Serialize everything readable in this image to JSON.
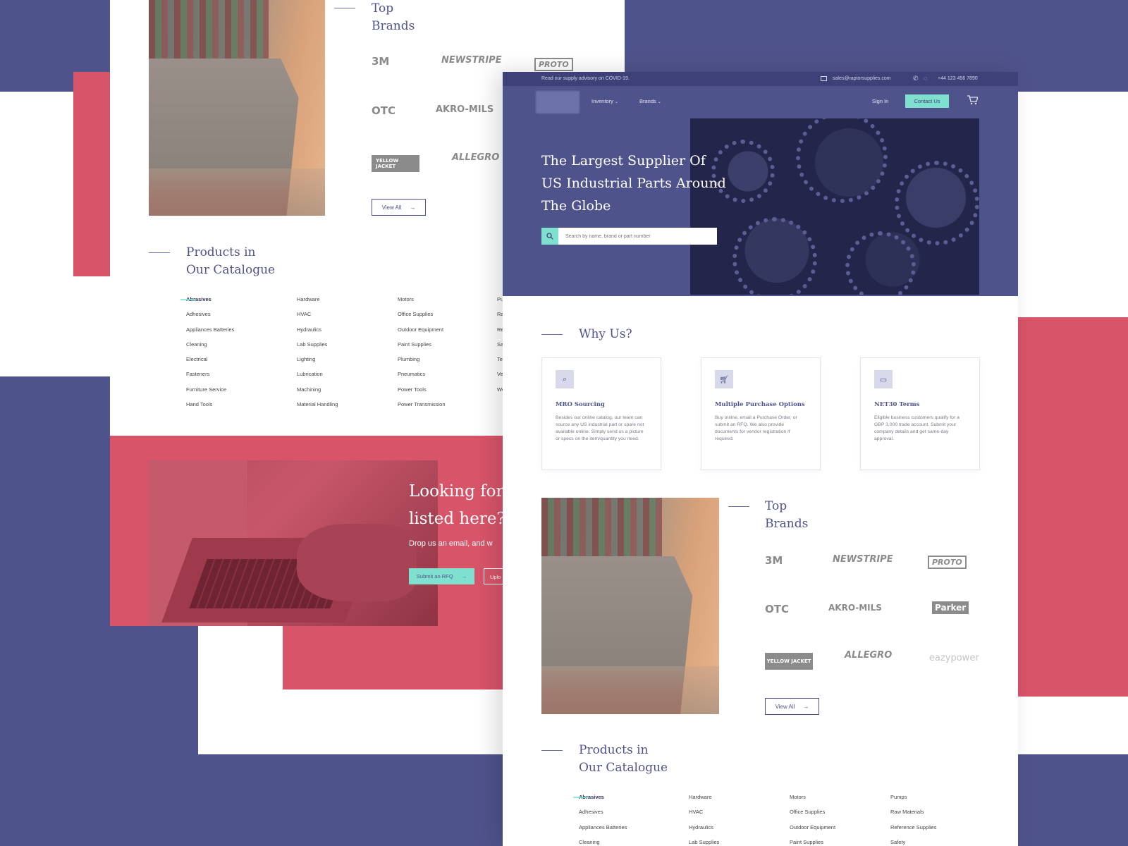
{
  "colors": {
    "primary_purple": "#4f538b",
    "accent_red": "#d85469",
    "accent_mint": "#7fe0cf"
  },
  "back_page": {
    "top_brands_title": [
      "Top",
      "Brands"
    ],
    "brands": [
      "3M",
      "NEWSTRIPE",
      "PROTO",
      "OTC",
      "AKRO-MILS",
      "YELLOW JACKET",
      "ALLEGRO"
    ],
    "view_all_label": "View All",
    "catalogue_title": [
      "Products in",
      "Our Catalogue"
    ],
    "catalogue_columns": [
      [
        "Abrasives",
        "Adhesives",
        "Appliances Batteries",
        "Cleaning",
        "Electrical",
        "Fasteners",
        "Furniture Service",
        "Hand Tools"
      ],
      [
        "Hardware",
        "HVAC",
        "Hydraulics",
        "Lab Supplies",
        "Lighting",
        "Lubrication",
        "Machining",
        "Material Handling"
      ],
      [
        "Motors",
        "Office Supplies",
        "Outdoor Equipment",
        "Paint Supplies",
        "Plumbing",
        "Pneumatics",
        "Power Tools",
        "Power Transmission"
      ],
      [
        "Pu",
        "Ra",
        "Re",
        "Sa",
        "Te",
        "Ve",
        "Wo"
      ]
    ],
    "rfq_heading": [
      "Looking for",
      "listed here?"
    ],
    "rfq_sub": "Drop us an email, and w",
    "submit_rfq_label": "Submit an RFQ",
    "upload_label": "Uplo"
  },
  "front_page": {
    "topbar": {
      "advisory": "Read our supply advisory on COVID-19.",
      "email": "sales@raptorsupplies.com",
      "phone": "+44 123 456 7890"
    },
    "nav": {
      "inventory_label": "Inventory",
      "brands_label": "Brands",
      "sign_in_label": "Sign In",
      "contact_label": "Contact Us"
    },
    "hero": {
      "title_lines": [
        "The Largest Supplier Of",
        "US Industrial Parts Around",
        "The Globe"
      ],
      "search_placeholder": "Search by name, brand or part number"
    },
    "why_us": {
      "title": "Why Us?",
      "cards": [
        {
          "icon": "document-search-icon",
          "title": "MRO Sourcing",
          "body": "Besides our online catalog, our team can source any US industrial part or spare not available online. Simply send us a picture or specs on the item/quantity you need."
        },
        {
          "icon": "cart-icon",
          "title": "Multiple Purchase Options",
          "body": "Buy online, email a Purchase Order, or submit an RFQ. We also provide documents for vendor registration if required."
        },
        {
          "icon": "credit-card-icon",
          "title": "NET30 Terms",
          "body": "Eligible business customers qualify for a GBP 3,000 trade account. Submit your company details and get same-day approval."
        }
      ]
    },
    "top_brands_title": [
      "Top",
      "Brands"
    ],
    "brands": [
      "3M",
      "NEWSTRIPE",
      "PROTO",
      "OTC",
      "AKRO-MILS",
      "Parker",
      "YELLOW JACKET",
      "ALLEGRO",
      "eazypower"
    ],
    "view_all_label": "View All",
    "catalogue_title": [
      "Products in",
      "Our Catalogue"
    ],
    "catalogue_columns": [
      [
        "Abrasives",
        "Adhesives",
        "Appliances Batteries",
        "Cleaning"
      ],
      [
        "Hardware",
        "HVAC",
        "Hydraulics",
        "Lab Supplies"
      ],
      [
        "Motors",
        "Office Supplies",
        "Outdoor Equipment",
        "Paint Supplies"
      ],
      [
        "Pumps",
        "Raw Materials",
        "Reference Supplies",
        "Safety"
      ]
    ]
  }
}
